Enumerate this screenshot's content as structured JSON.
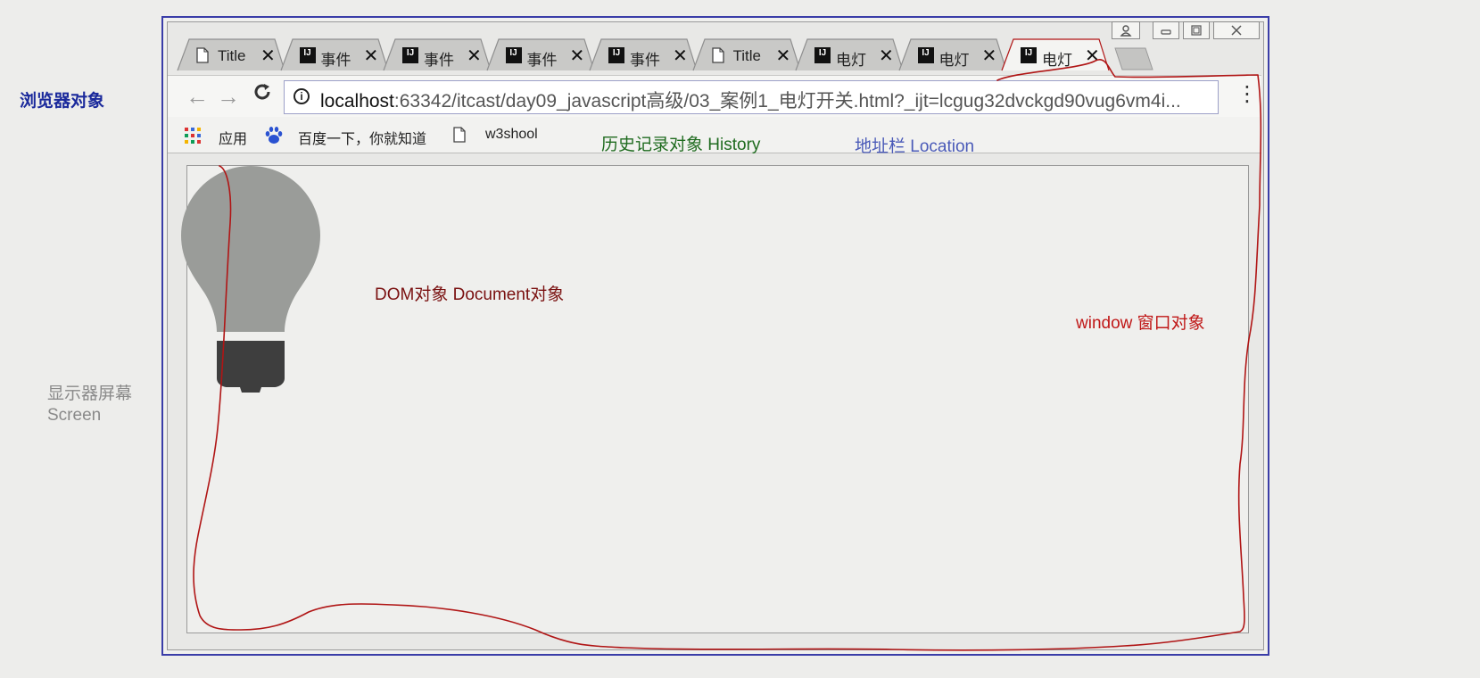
{
  "annotations": {
    "browser_object": "浏览器对象",
    "screen_line1": "显示器屏幕",
    "screen_line2": "Screen",
    "history": "历史记录对象 History",
    "location": "地址栏 Location",
    "dom": "DOM对象 Document对象",
    "window": "window 窗口对象"
  },
  "colors": {
    "browser_object": "#1b2a9c",
    "screen": "#8a8a8a",
    "history": "#1f6b1f",
    "location": "#4a5ab8",
    "dom": "#7a1010",
    "window": "#c01818",
    "outline_stroke": "#b01515",
    "frame_border": "#3a3da8"
  },
  "tabs": [
    {
      "icon": "page-icon",
      "title": "Title"
    },
    {
      "icon": "intellij-icon",
      "title": "事件"
    },
    {
      "icon": "intellij-icon",
      "title": "事件"
    },
    {
      "icon": "intellij-icon",
      "title": "事件"
    },
    {
      "icon": "intellij-icon",
      "title": "事件"
    },
    {
      "icon": "page-icon",
      "title": "Title"
    },
    {
      "icon": "intellij-icon",
      "title": "电灯"
    },
    {
      "icon": "intellij-icon",
      "title": "电灯"
    },
    {
      "icon": "intellij-icon",
      "title": "电灯",
      "active": true
    }
  ],
  "tab_close_glyph": "✕",
  "window_controls": {
    "profile": "profile-icon",
    "minimize": "minimize-icon",
    "maximize": "restore-icon",
    "close": "close-icon"
  },
  "toolbar": {
    "back_glyph": "←",
    "forward_glyph": "→",
    "reload_glyph": "C",
    "info_glyph": "i",
    "url_host": "localhost",
    "url_rest": ":63342/itcast/day09_javascript高级/03_案例1_电灯开关.html?_ijt=lcgug32dvckgd90vug6vm4i...",
    "star_glyph": "☆",
    "menu_glyph": "⋮"
  },
  "bookmarks": {
    "apps": "应用",
    "baidu": "百度一下，你就知道",
    "w3school": "w3shool"
  },
  "content": {
    "image": "light-bulb-off"
  }
}
